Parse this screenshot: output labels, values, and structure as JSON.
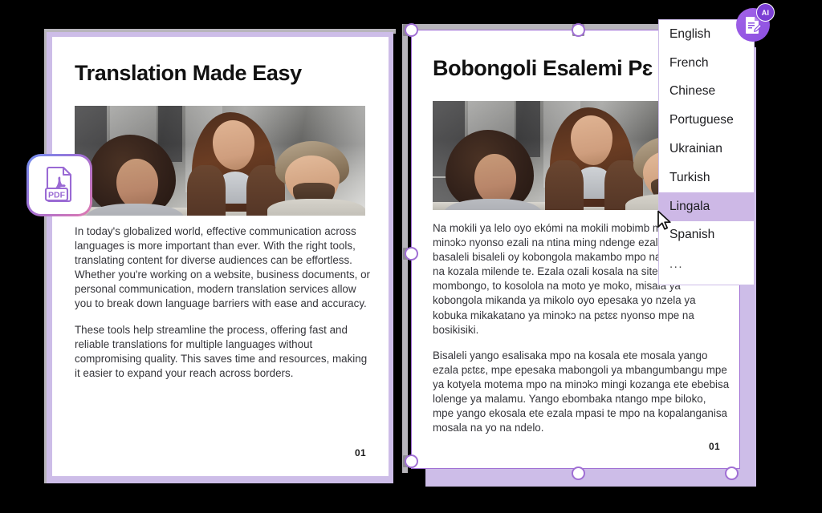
{
  "canvas": {
    "background": "#000000",
    "accent": "#a06fd4",
    "card_border": "#cdbde8",
    "highlight": "#cdb8e6"
  },
  "documents": [
    {
      "id": "source-document",
      "title": "Translation Made Easy",
      "page_number": "01",
      "photo_alt": "three-colleagues-smiling-at-laptop-photo",
      "paragraphs": [
        "In today's globalized world, effective communication across languages is more important than ever. With the right tools, translating content for diverse audiences can be effortless. Whether you're working on a website, business documents, or personal communication, modern translation services allow you to break down language barriers with ease and accuracy.",
        "These tools help streamline the process, offering fast and reliable translations for multiple languages without compromising quality. This saves time and resources, making it easier to expand your reach across borders."
      ]
    },
    {
      "id": "translated-document",
      "title": "Bobongoli Esalemi Pɛ",
      "page_number": "01",
      "photo_alt": "three-colleagues-smiling-at-laptop-photo",
      "paragraphs": [
        "Na mokili ya lelo oyo ekómi na mokili mobimb malamu na minɔkɔ nyonso ezali na ntina ming ndenge ezalaki liboso. Soki basaleli bisaleli oy kobongola makambo mpo na bato ndenge na kozala milende te. Ezala ozali kosala na site In mikanda ya mombongo, to kosolola na moto ye moko, misala ya kobongola mikanda ya mikolo oyo epesaka yo nzela ya kobuka mikakatano ya minɔkɔ na pɛtɛɛ nyonso mpe na bosikisiki.",
        "Bisaleli yango esalisaka mpo na kosala ete mosala yango ezala pɛtɛɛ, mpe epesaka mabongoli ya mbangumbangu mpe ya kotyela motema mpo na minɔkɔ mingi kozanga ete ebebisa lolenge ya malamu. Yango ebombaka ntango mpe biloko, mpe yango ekosala ete ezala mpasi te mpo na kopalanganisa mosala na yo na ndelo."
      ]
    }
  ],
  "language_dropdown": {
    "selected": "Lingala",
    "items": [
      {
        "label": "English",
        "selected": false
      },
      {
        "label": "French",
        "selected": false
      },
      {
        "label": "Chinese",
        "selected": false
      },
      {
        "label": "Portuguese",
        "selected": false
      },
      {
        "label": "Ukrainian",
        "selected": false
      },
      {
        "label": "Turkish",
        "selected": false
      },
      {
        "label": "Lingala",
        "selected": true
      },
      {
        "label": "Spanish",
        "selected": false
      },
      {
        "label": "...",
        "selected": false
      }
    ]
  },
  "ai_badge": {
    "chip_label": "AI",
    "icon": "document-edit-icon"
  },
  "pdf_badge": {
    "icon": "pdf-file-icon",
    "label": "PDF"
  },
  "cursor": {
    "icon": "mouse-pointer-arrow"
  }
}
